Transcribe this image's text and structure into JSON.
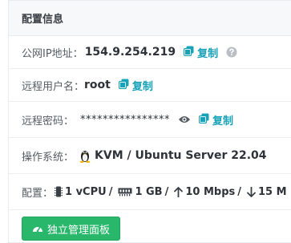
{
  "panel": {
    "title": "配置信息"
  },
  "rows": {
    "ip": {
      "label": "公网IP地址：",
      "value": "154.9.254.219",
      "copy_label": "复制",
      "copy_icon": "copy-icon",
      "help_icon": "question-circle-icon"
    },
    "user": {
      "label": "远程用户名：",
      "value": "root",
      "copy_label": "复制",
      "copy_icon": "copy-icon"
    },
    "password": {
      "label": "远程密码：",
      "value": "****************",
      "eye_icon": "eye-icon",
      "copy_label": "复制",
      "copy_icon": "copy-icon"
    },
    "os": {
      "label": "操作系统：",
      "logo_icon": "linux-tux-icon",
      "value": "KVM / Ubuntu Server 22.04"
    },
    "config": {
      "label": "配置：",
      "cpu": "1 vCPU",
      "ram": "1 GB",
      "up": "10 Mbps",
      "down": "15 M",
      "separator": "/",
      "cpu_icon": "microchip-icon",
      "ram_icon": "memory-icon",
      "up_icon": "arrow-up-icon",
      "down_icon": "arrow-down-icon"
    }
  },
  "button": {
    "label": "独立管理面板",
    "icon": "tachometer-icon"
  },
  "colors": {
    "accent": "#17a2b8",
    "button": "#28b76b",
    "header_bg": "#f6f8fa"
  }
}
